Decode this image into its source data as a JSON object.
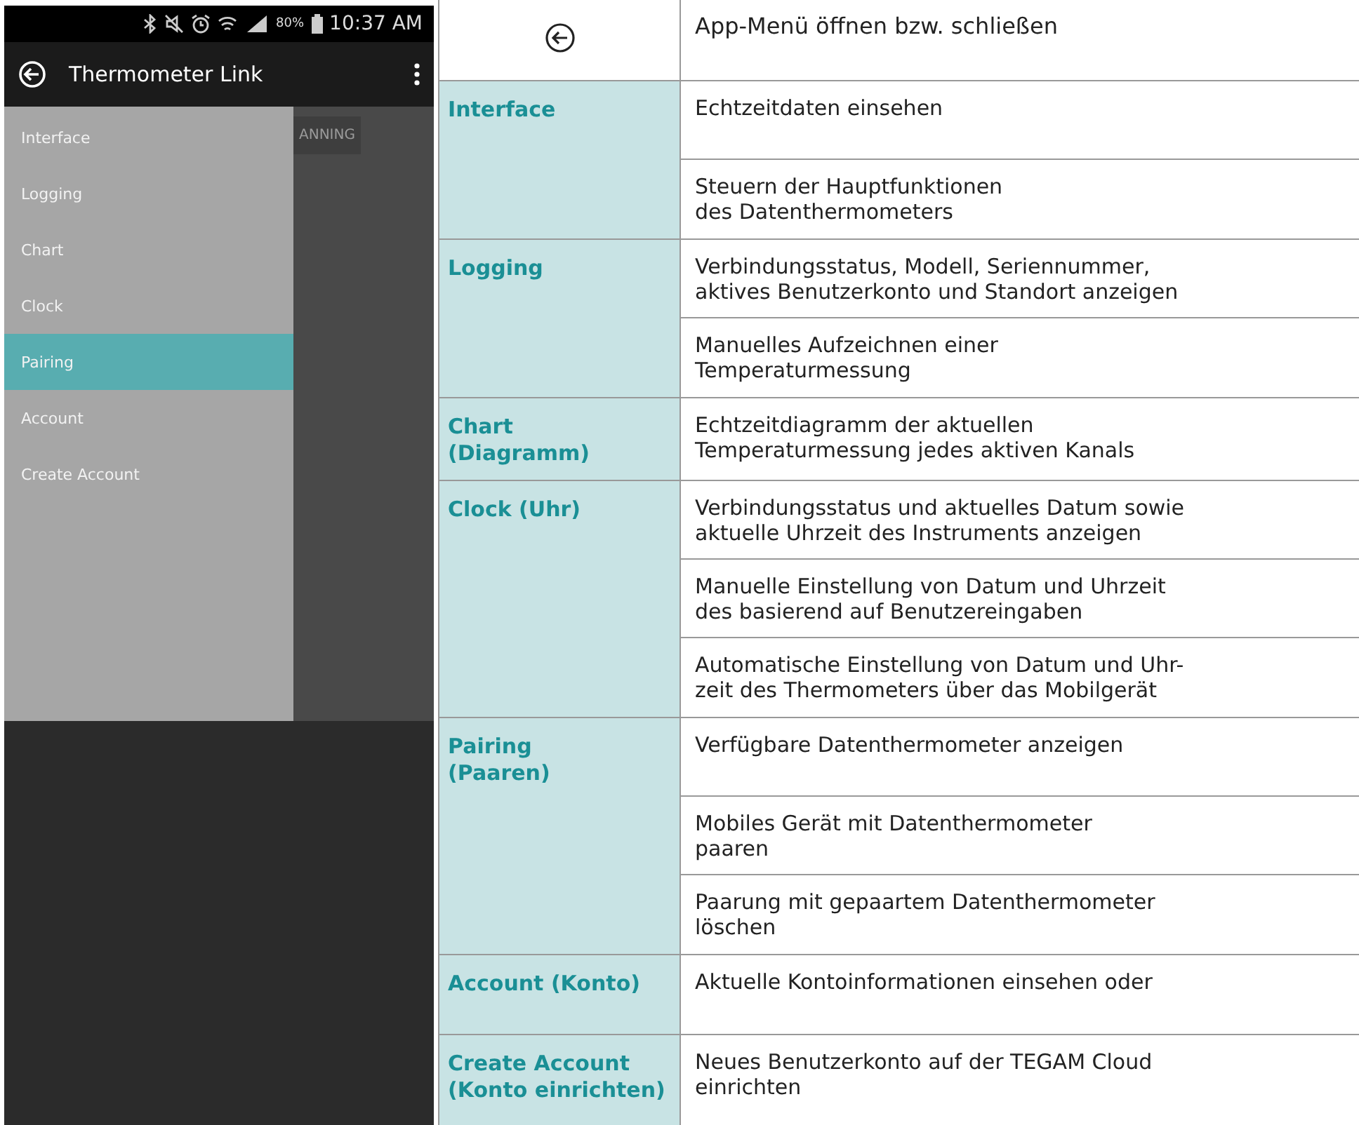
{
  "phone": {
    "status_bar": {
      "battery": "80%",
      "time": "10:37 AM"
    },
    "app_bar": {
      "title": "Thermometer Link"
    },
    "background_button": "ANNING",
    "drawer": {
      "items": [
        {
          "label": "Interface",
          "selected": false
        },
        {
          "label": "Logging",
          "selected": false
        },
        {
          "label": "Chart",
          "selected": false
        },
        {
          "label": "Clock",
          "selected": false
        },
        {
          "label": "Pairing",
          "selected": true
        },
        {
          "label": "Account",
          "selected": false
        },
        {
          "label": "Create Account",
          "selected": false
        }
      ]
    }
  },
  "table": {
    "header": {
      "text": "App-Menü öffnen bzw. schließen"
    },
    "rows": [
      {
        "label": "Interface",
        "functions": [
          "Echtzeitdaten einsehen",
          "Steuern der Hauptfunktionen\ndes Datenthermometers"
        ]
      },
      {
        "label": "Logging",
        "functions": [
          "Verbindungsstatus, Modell, Seriennummer,\naktives Benutzerkonto und Standort anzeigen",
          "Manuelles Aufzeichnen einer\nTemperaturmessung"
        ]
      },
      {
        "label": "Chart\n(Diagramm)",
        "functions": [
          "Echtzeitdiagramm der aktuellen\nTemperaturmessung jedes aktiven Kanals"
        ]
      },
      {
        "label": "Clock (Uhr)",
        "functions": [
          "Verbindungsstatus und aktuelles Datum sowie\naktuelle Uhrzeit des Instruments anzeigen",
          "Manuelle Einstellung von Datum und Uhrzeit\ndes basierend auf Benutzereingaben",
          "Automatische Einstellung von Datum und Uhr-\nzeit des Thermometers über das Mobilgerät"
        ]
      },
      {
        "label": "Pairing\n(Paaren)",
        "functions": [
          "Verfügbare Datenthermometer anzeigen",
          "Mobiles Gerät mit Datenthermometer\npaaren",
          "Paarung mit gepaartem Datenthermometer\nlöschen"
        ]
      },
      {
        "label": "Account (Konto)",
        "functions": [
          "Aktuelle Kontoinformationen einsehen oder"
        ]
      },
      {
        "label": "Create Account\n(Konto einrichten)",
        "functions": [
          "Neues Benutzerkonto auf der TEGAM Cloud\neinrichten"
        ]
      }
    ]
  }
}
